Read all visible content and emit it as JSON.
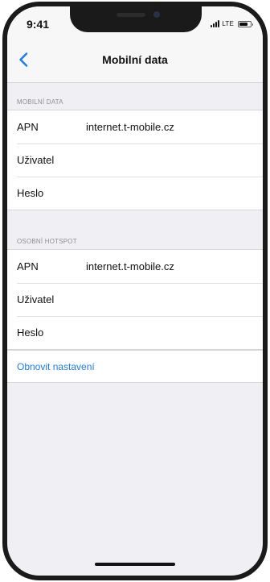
{
  "status_bar": {
    "time": "9:41",
    "network": "LTE",
    "battery_level": 0.75
  },
  "nav": {
    "title": "Mobilní data",
    "back_icon": "chevron-left-icon"
  },
  "sections": [
    {
      "header": "MOBILNÍ DATA",
      "rows": [
        {
          "label": "APN",
          "value": "internet.t-mobile.cz"
        },
        {
          "label": "Uživatel",
          "value": ""
        },
        {
          "label": "Heslo",
          "value": ""
        }
      ]
    },
    {
      "header": "OSOBNÍ HOTSPOT",
      "rows": [
        {
          "label": "APN",
          "value": "internet.t-mobile.cz"
        },
        {
          "label": "Uživatel",
          "value": ""
        },
        {
          "label": "Heslo",
          "value": ""
        }
      ]
    }
  ],
  "reset": {
    "label": "Obnovit nastavení"
  },
  "colors": {
    "accent": "#1a7cf5",
    "background": "#efeff4",
    "section_header": "#8e8e93"
  }
}
